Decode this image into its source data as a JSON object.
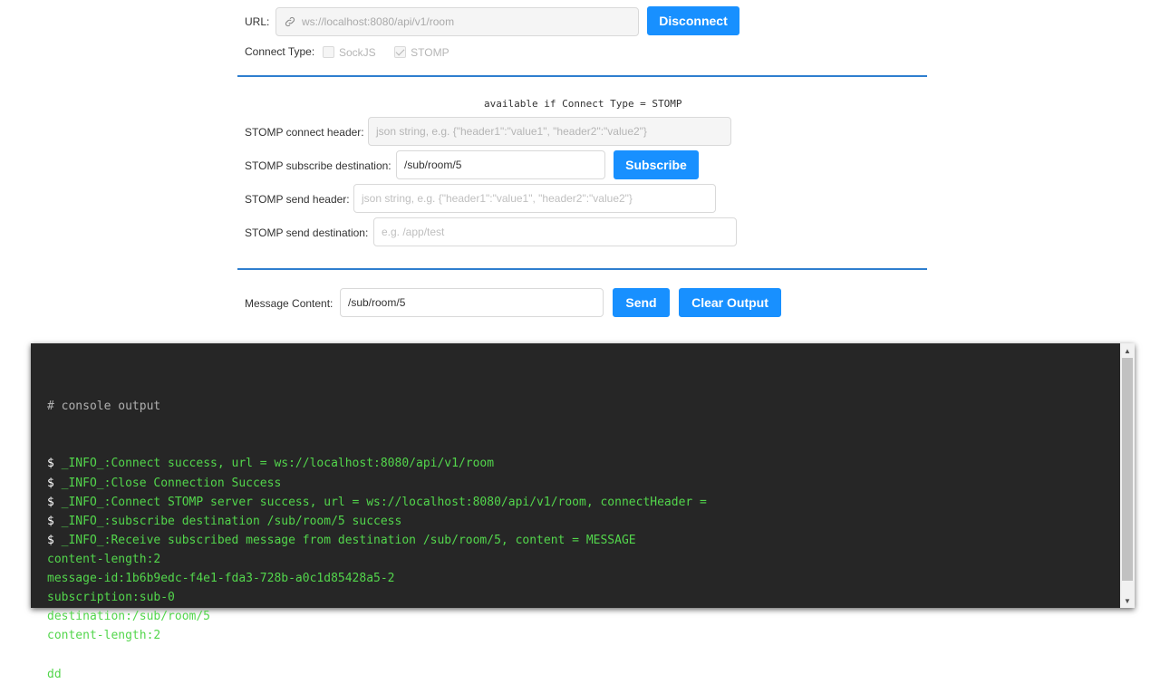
{
  "url_row": {
    "label": "URL:",
    "value": "ws://localhost:8080/api/v1/room",
    "button": "Disconnect",
    "icon": "link-icon"
  },
  "connect_type": {
    "label": "Connect Type:",
    "options": [
      {
        "label": "SockJS",
        "checked": false
      },
      {
        "label": "STOMP",
        "checked": true
      }
    ]
  },
  "stomp": {
    "note": "available if Connect Type = STOMP",
    "connect_header_label": "STOMP connect header:",
    "connect_header_placeholder": "json string, e.g. {\"header1\":\"value1\", \"header2\":\"value2\"}",
    "subscribe_label": "STOMP subscribe destination:",
    "subscribe_value": "/sub/room/5",
    "subscribe_button": "Subscribe",
    "send_header_label": "STOMP send header:",
    "send_header_placeholder": "json string, e.g. {\"header1\":\"value1\", \"header2\":\"value2\"}",
    "send_dest_label": "STOMP send destination:",
    "send_dest_placeholder": "e.g. /app/test"
  },
  "message": {
    "label": "Message Content:",
    "value": "/sub/room/5",
    "send_button": "Send",
    "clear_button": "Clear Output"
  },
  "console": {
    "comment": "# console output",
    "lines": [
      {
        "prompt": "$ ",
        "text": "_INFO_:Connect success, url = ws://localhost:8080/api/v1/room"
      },
      {
        "prompt": "$ ",
        "text": "_INFO_:Close Connection Success"
      },
      {
        "prompt": "$ ",
        "text": "_INFO_:Connect STOMP server success, url = ws://localhost:8080/api/v1/room, connectHeader ="
      },
      {
        "prompt": "$ ",
        "text": "_INFO_:subscribe destination /sub/room/5 success"
      },
      {
        "prompt": "$ ",
        "text": "_INFO_:Receive subscribed message from destination /sub/room/5, content = MESSAGE"
      },
      {
        "prompt": "",
        "text": "content-length:2"
      },
      {
        "prompt": "",
        "text": "message-id:1b6b9edc-f4e1-fda3-728b-a0c1d85428a5-2"
      },
      {
        "prompt": "",
        "text": "subscription:sub-0"
      },
      {
        "prompt": "",
        "text": "destination:/sub/room/5"
      },
      {
        "prompt": "",
        "text": "content-length:2"
      },
      {
        "prompt": "",
        "text": ""
      },
      {
        "prompt": "",
        "text": "dd"
      }
    ]
  },
  "colors": {
    "accent": "#1890ff",
    "divider": "#2f7fcf",
    "console_bg": "#262626",
    "console_info": "#53d64c"
  }
}
